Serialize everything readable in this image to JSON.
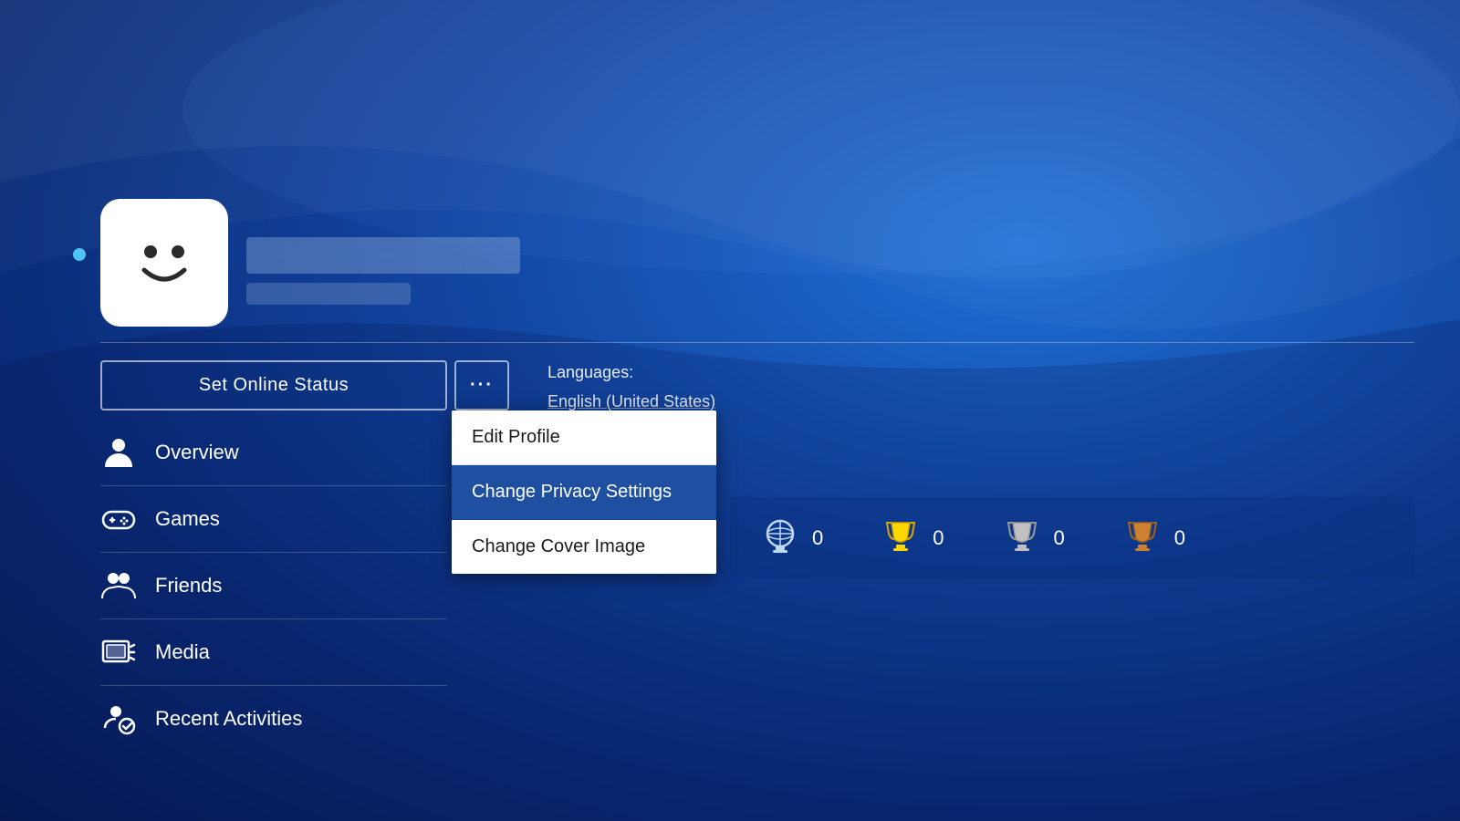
{
  "background": {
    "base_color": "#1244a0"
  },
  "header": {
    "online_indicator": "online",
    "username_display": "[blurred]",
    "username_sub": "[blurred]"
  },
  "online_status_button": {
    "label": "Set Online Status"
  },
  "more_button": {
    "label": "···"
  },
  "languages": {
    "label": "Languages:",
    "value": "English (United States)"
  },
  "dropdown": {
    "items": [
      {
        "id": "edit-profile",
        "label": "Edit Profile",
        "highlighted": false
      },
      {
        "id": "change-privacy-settings",
        "label": "Change Privacy Settings",
        "highlighted": true
      },
      {
        "id": "change-cover-image",
        "label": "Change Cover Image",
        "highlighted": false
      }
    ]
  },
  "nav": {
    "items": [
      {
        "id": "overview",
        "label": "Overview",
        "icon": "person-icon"
      },
      {
        "id": "games",
        "label": "Games",
        "icon": "gamepad-icon"
      },
      {
        "id": "friends",
        "label": "Friends",
        "icon": "friends-icon"
      },
      {
        "id": "media",
        "label": "Media",
        "icon": "media-icon"
      },
      {
        "id": "recent-activities",
        "label": "Recent Activities",
        "icon": "activities-icon"
      }
    ]
  },
  "trophies": {
    "platinum": {
      "label": "0",
      "type": "platinum"
    },
    "gold": {
      "label": "0",
      "type": "gold"
    },
    "silver": {
      "label": "0",
      "type": "silver"
    },
    "bronze": {
      "label": "0",
      "type": "bronze"
    }
  }
}
